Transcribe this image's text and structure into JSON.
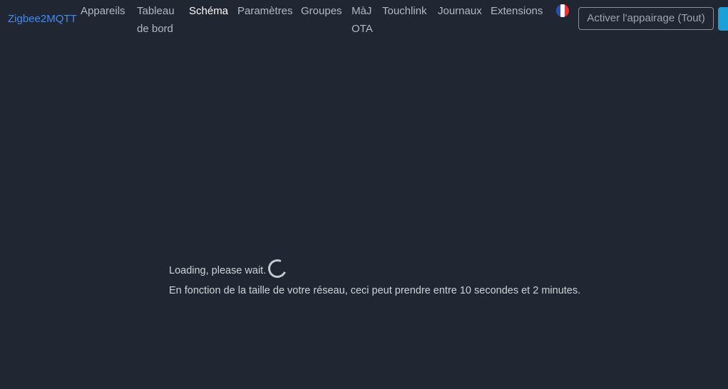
{
  "navbar": {
    "brand": "Zigbee2MQTT",
    "links": [
      {
        "line1": "Appareils",
        "line2": ""
      },
      {
        "line1": "Tableau",
        "line2": "de bord"
      },
      {
        "line1": "Schéma",
        "line2": ""
      },
      {
        "line1": "Paramètres",
        "line2": ""
      },
      {
        "line1": "Groupes",
        "line2": ""
      },
      {
        "line1": "MàJ",
        "line2": "OTA"
      },
      {
        "line1": "Touchlink",
        "line2": ""
      },
      {
        "line1": "Journaux",
        "line2": ""
      },
      {
        "line1": "Extensions",
        "line2": ""
      }
    ],
    "active_link": "Schéma",
    "language_icon": "flag-fr-icon",
    "permit_join_label": "Activer l'appairage (Tout)"
  },
  "main": {
    "loading_text": "Loading, please wait.",
    "loading_hint": "En fonction de la taille de votre réseau, ceci peut prendre entre 10 secondes et 2 minutes."
  },
  "colors": {
    "background": "#212633",
    "brand": "#3d8bfd",
    "accent": "#1ba1d8"
  }
}
